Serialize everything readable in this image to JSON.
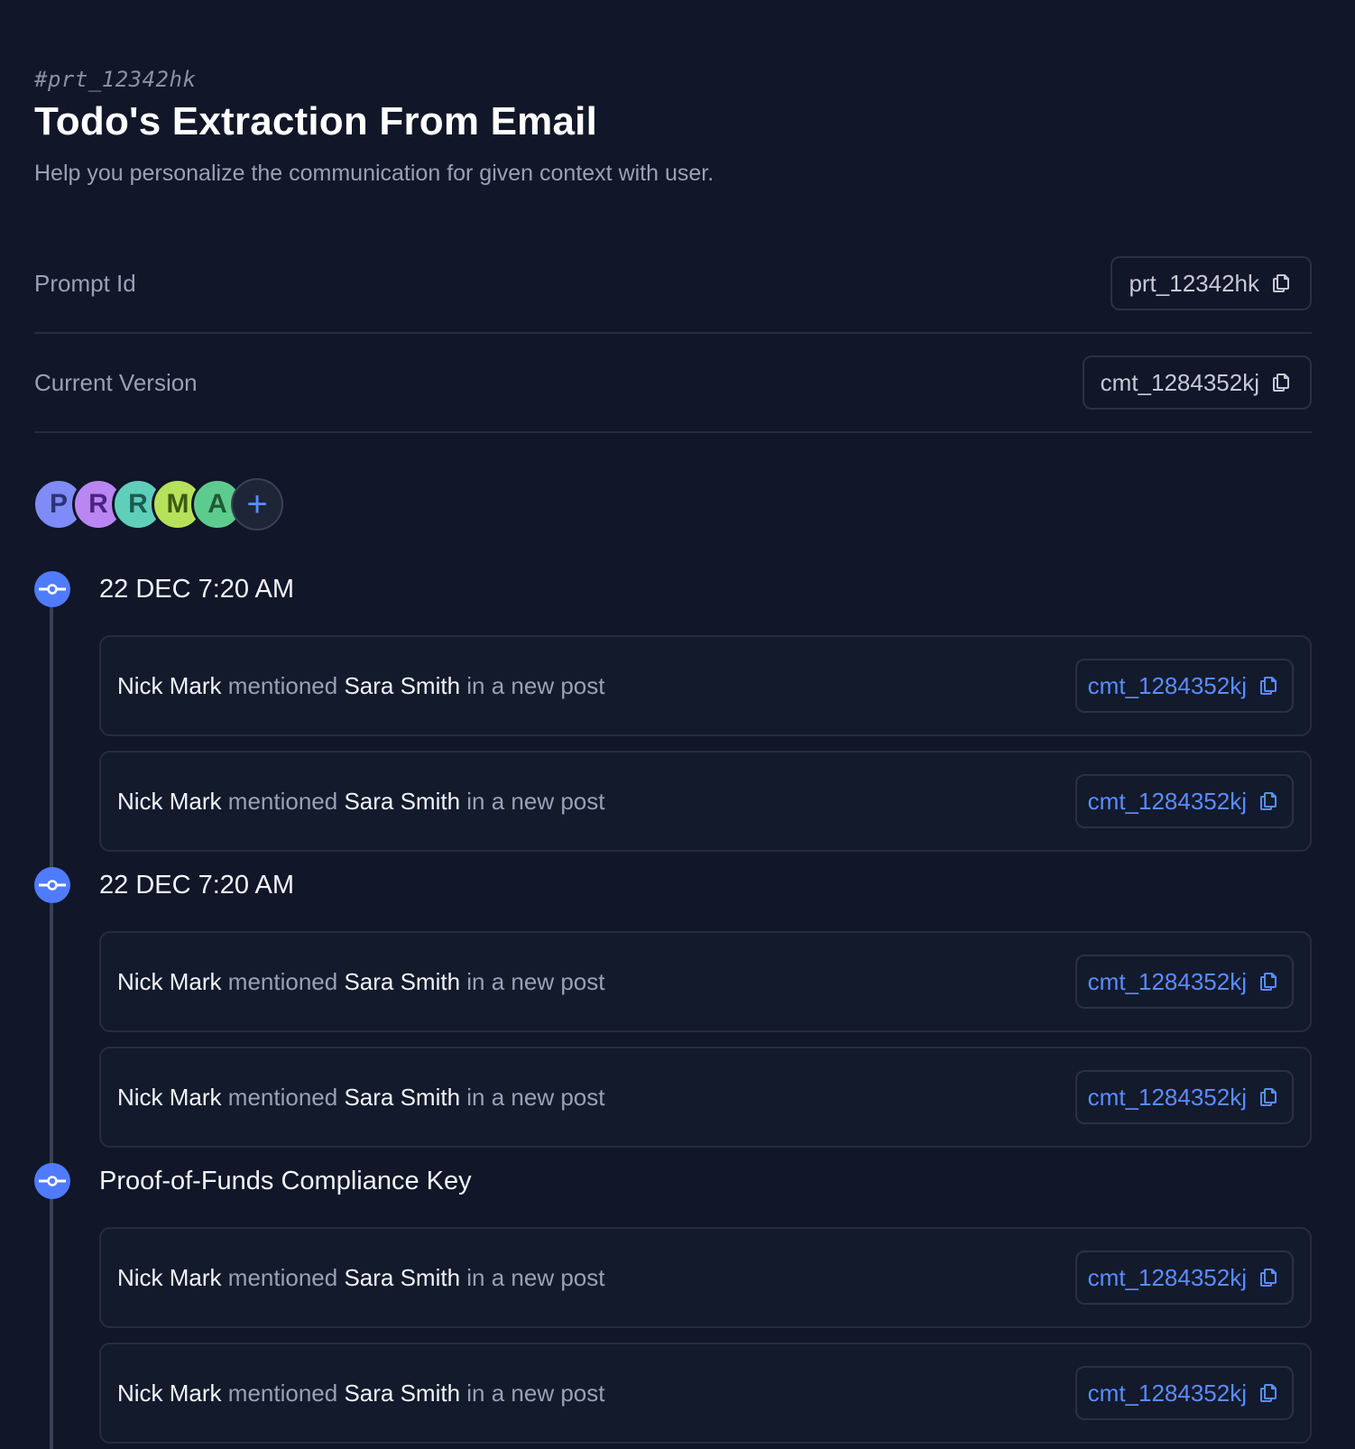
{
  "header": {
    "prompt_tag": "#prt_12342hk",
    "title": "Todo's Extraction From Email",
    "subtitle": "Help you personalize the communication for given context with user."
  },
  "meta": [
    {
      "label": "Prompt Id",
      "value": "prt_12342hk"
    },
    {
      "label": "Current Version",
      "value": "cmt_1284352kj"
    }
  ],
  "avatars": [
    {
      "initial": "P",
      "bg": "#7f8cf7",
      "fg": "#2c3476"
    },
    {
      "initial": "R",
      "bg": "#b986f2",
      "fg": "#4b2384"
    },
    {
      "initial": "R",
      "bg": "#5fcfba",
      "fg": "#1d5b50"
    },
    {
      "initial": "M",
      "bg": "#b5e25a",
      "fg": "#3f5a13"
    },
    {
      "initial": "A",
      "bg": "#5ecb8e",
      "fg": "#1f5a38"
    }
  ],
  "add_avatar_label": "+",
  "sections": [
    {
      "title": "22 DEC 7:20 AM",
      "entries": [
        {
          "actor": "Nick Mark",
          "verb": "mentioned",
          "target": "Sara Smith",
          "suffix": "in a new post",
          "commit": "cmt_1284352kj"
        },
        {
          "actor": "Nick Mark",
          "verb": "mentioned",
          "target": "Sara Smith",
          "suffix": "in a new post",
          "commit": "cmt_1284352kj"
        }
      ]
    },
    {
      "title": "22 DEC 7:20 AM",
      "entries": [
        {
          "actor": "Nick Mark",
          "verb": "mentioned",
          "target": "Sara Smith",
          "suffix": "in a new post",
          "commit": "cmt_1284352kj"
        },
        {
          "actor": "Nick Mark",
          "verb": "mentioned",
          "target": "Sara Smith",
          "suffix": "in a new post",
          "commit": "cmt_1284352kj"
        }
      ]
    },
    {
      "title": "Proof-of-Funds Compliance Key",
      "entries": [
        {
          "actor": "Nick Mark",
          "verb": "mentioned",
          "target": "Sara Smith",
          "suffix": "in a new post",
          "commit": "cmt_1284352kj"
        },
        {
          "actor": "Nick Mark",
          "verb": "mentioned",
          "target": "Sara Smith",
          "suffix": "in a new post",
          "commit": "cmt_1284352kj"
        }
      ]
    }
  ],
  "icons": {
    "copy": "copy-icon",
    "commit": "git-commit-icon",
    "add": "plus-icon"
  },
  "colors": {
    "background": "#111628",
    "accent": "#4f7cff",
    "link": "#5b8cff"
  }
}
